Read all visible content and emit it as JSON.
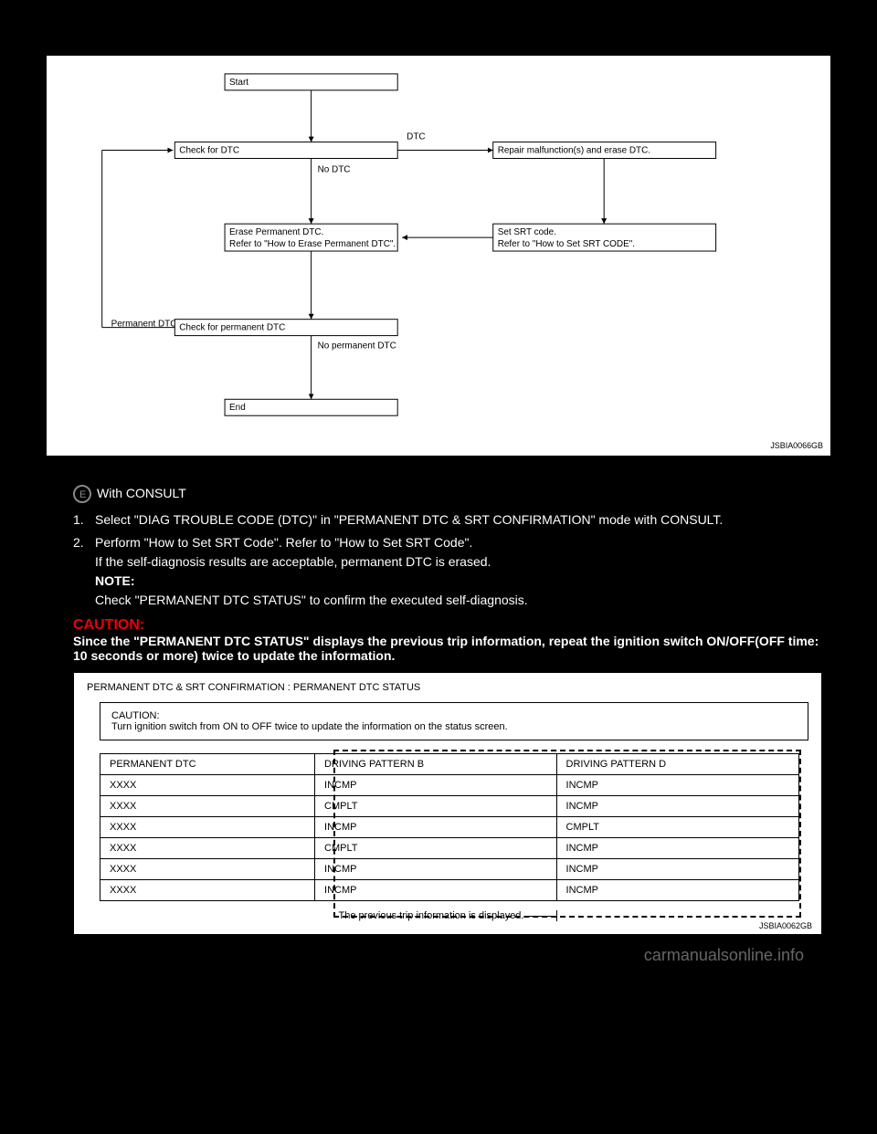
{
  "flowchart": {
    "start": "Start",
    "check_dtc": "Check for DTC",
    "dtc_label": "DTC",
    "no_dtc_label": "No DTC",
    "repair": "Repair malfunction(s) and erase DTC.",
    "erase_line1": "Erase Permanent DTC.",
    "erase_line2": "Refer to \"How to Erase Permanent DTC\".",
    "set_srt_line1": "Set SRT code.",
    "set_srt_line2": "Refer to \"How to Set SRT CODE\".",
    "permanent_dtc_label": "Permanent DTC",
    "check_perm": "Check for permanent DTC",
    "no_perm_label": "No permanent DTC",
    "end": "End",
    "fig_id": "JSBIA0066GB"
  },
  "body": {
    "with_consult": "With CONSULT",
    "step1": "Select \"DIAG TROUBLE CODE (DTC)\" in \"PERMANENT DTC & SRT CONFIRMATION\" mode with CONSULT.",
    "step2": "Perform \"How to Set SRT Code\". Refer to \"How to Set SRT Code\".",
    "step2_cont": "If the self-diagnosis results are acceptable, permanent DTC is erased.",
    "note_label": "NOTE:",
    "note_text": "Check \"PERMANENT DTC STATUS\" to confirm the executed self-diagnosis.",
    "caution_label": "CAUTION:",
    "caution_text": "Since the \"PERMANENT DTC STATUS\" displays the previous trip information, repeat the ignition switch ON/OFF(OFF time: 10 seconds or more) twice to update the information."
  },
  "table": {
    "title": "PERMANENT DTC & SRT CONFIRMATION : PERMANENT DTC STATUS",
    "caution_box_label": "CAUTION:",
    "caution_box_text": "Turn ignition switch from ON to OFF twice to update the information on the status screen.",
    "headers": [
      "PERMANENT DTC",
      "DRIVING PATTERN B",
      "DRIVING PATTERN D"
    ],
    "rows": [
      [
        "XXXX",
        "INCMP",
        "INCMP"
      ],
      [
        "XXXX",
        "CMPLT",
        "INCMP"
      ],
      [
        "XXXX",
        "INCMP",
        "CMPLT"
      ],
      [
        "XXXX",
        "CMPLT",
        "INCMP"
      ],
      [
        "XXXX",
        "INCMP",
        "INCMP"
      ],
      [
        "XXXX",
        "INCMP",
        "INCMP"
      ]
    ],
    "footer": "The previous trip information is displayed.",
    "fig_id": "JSBIA0062GB"
  },
  "watermark": "carmanualsonline.info"
}
